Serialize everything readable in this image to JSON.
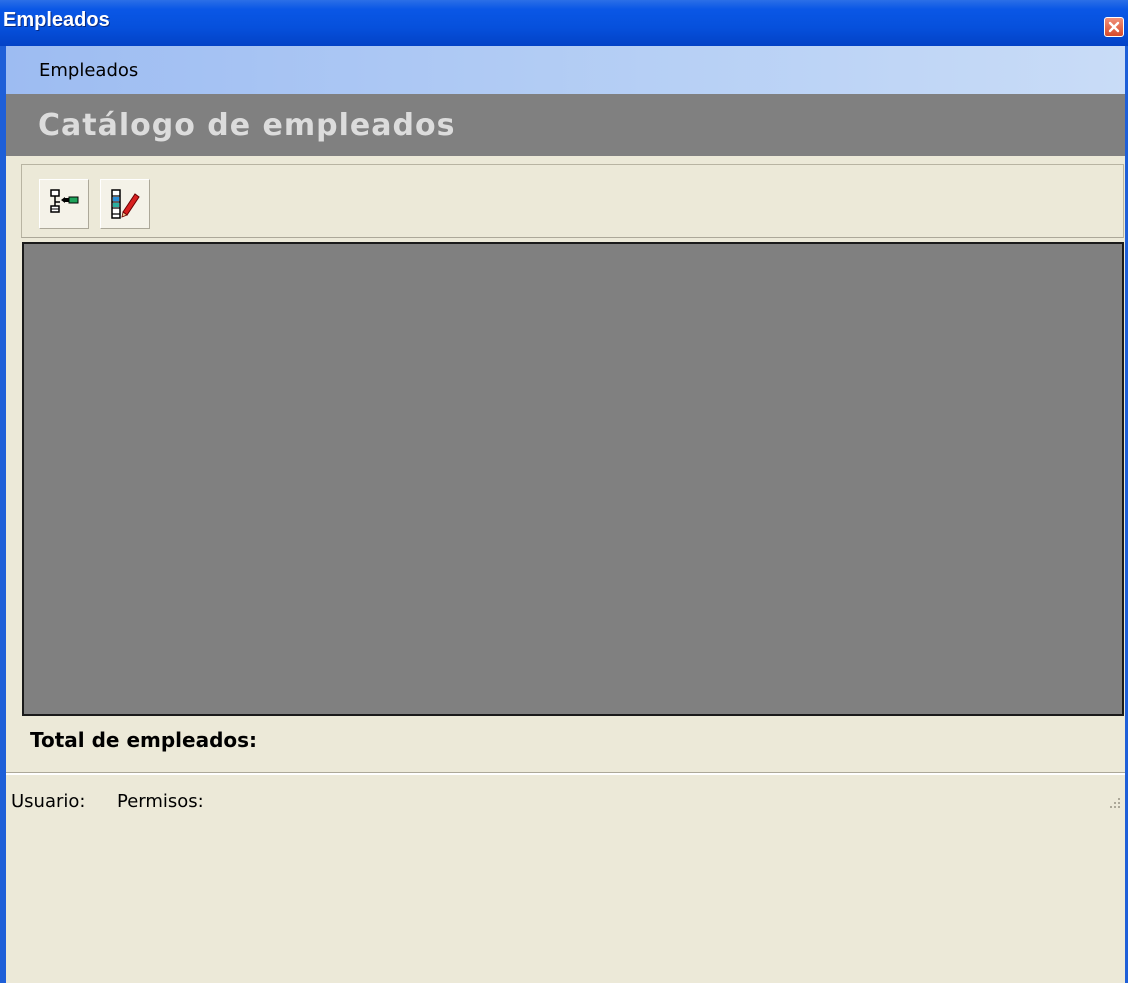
{
  "window": {
    "title": "Empleados"
  },
  "menu": {
    "items": [
      {
        "label": "Empleados"
      }
    ]
  },
  "header": {
    "title": "Catálogo de empleados"
  },
  "toolbar": {
    "buttons": [
      {
        "name": "insert-node-icon"
      },
      {
        "name": "edit-list-icon"
      }
    ]
  },
  "summary": {
    "total_label": "Total de empleados:"
  },
  "status": {
    "user_label": "Usuario:",
    "permissions_label": "Permisos:"
  },
  "colors": {
    "titlebar": "#0650dc",
    "menubar": "#b7d0f5",
    "header_band": "#808080",
    "grid_background": "#808080",
    "body": "#ece9d8"
  }
}
